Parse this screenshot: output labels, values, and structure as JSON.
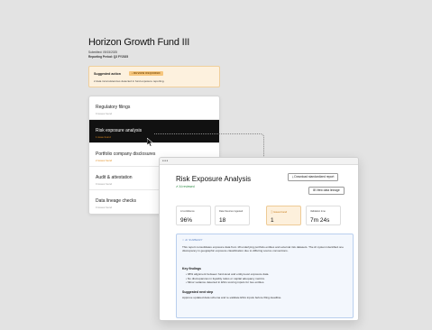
{
  "fund": {
    "title": "Horizon Growth Fund III",
    "submitted": "Submitted: 09/15/2025",
    "period": "Reporting Period: Q3 FY2025"
  },
  "alert": {
    "label": "Suggested action",
    "badge": "• REVIEW REQUIRED",
    "message": "2 data inconsistencies detected in fund exposure reporting."
  },
  "checks": [
    {
      "title": "Regulatory filings",
      "status": "0 issues found"
    },
    {
      "title": "Risk exposure analysis",
      "status": "1 issue found",
      "active": true
    },
    {
      "title": "Portfolio company disclosures",
      "status": "2 issues found"
    },
    {
      "title": "Audit & attestation",
      "status": "0 issues found"
    },
    {
      "title": "Data lineage checks",
      "status": "0 issues found"
    }
  ],
  "detail": {
    "title": "Risk Exposure Analysis",
    "review_status": "✔ AI reviewed",
    "download_button": "⤓  Download standardized report",
    "lineage_button": "⊞  View data lineage",
    "metrics": [
      {
        "label": "AI confidence",
        "value": "96%"
      },
      {
        "label": "Data Sources ingested",
        "value": "18"
      },
      {
        "label": "ⓘ Issues found",
        "value": "1"
      },
      {
        "label": "Validation time",
        "value": "7m 24s"
      }
    ],
    "summary": {
      "tag": "✧ AI SUMMARY",
      "body": "This report consolidates exposure data from 18 underlying portfolio entities and external risk datasets. The AI system identified one discrepancy in geographic exposure classification due to differing source conventions.",
      "findings_heading": "Key findings",
      "findings": [
        "98% alignment between fund-level and entity-level exposure data.",
        "No discrepancies in liquidity ratios or capital adequacy metrics.",
        "Minor variance detected in ESG scoring inputs for two entities."
      ],
      "next_heading": "Suggested next step",
      "next_body": "Approve updated data schema and re-validate ESG inputs before filing deadline."
    }
  },
  "colors": {
    "accent_warning": "#f6c67d",
    "active_row": "#111111",
    "success": "#2e8b46",
    "summary_border": "#b9cfee"
  }
}
